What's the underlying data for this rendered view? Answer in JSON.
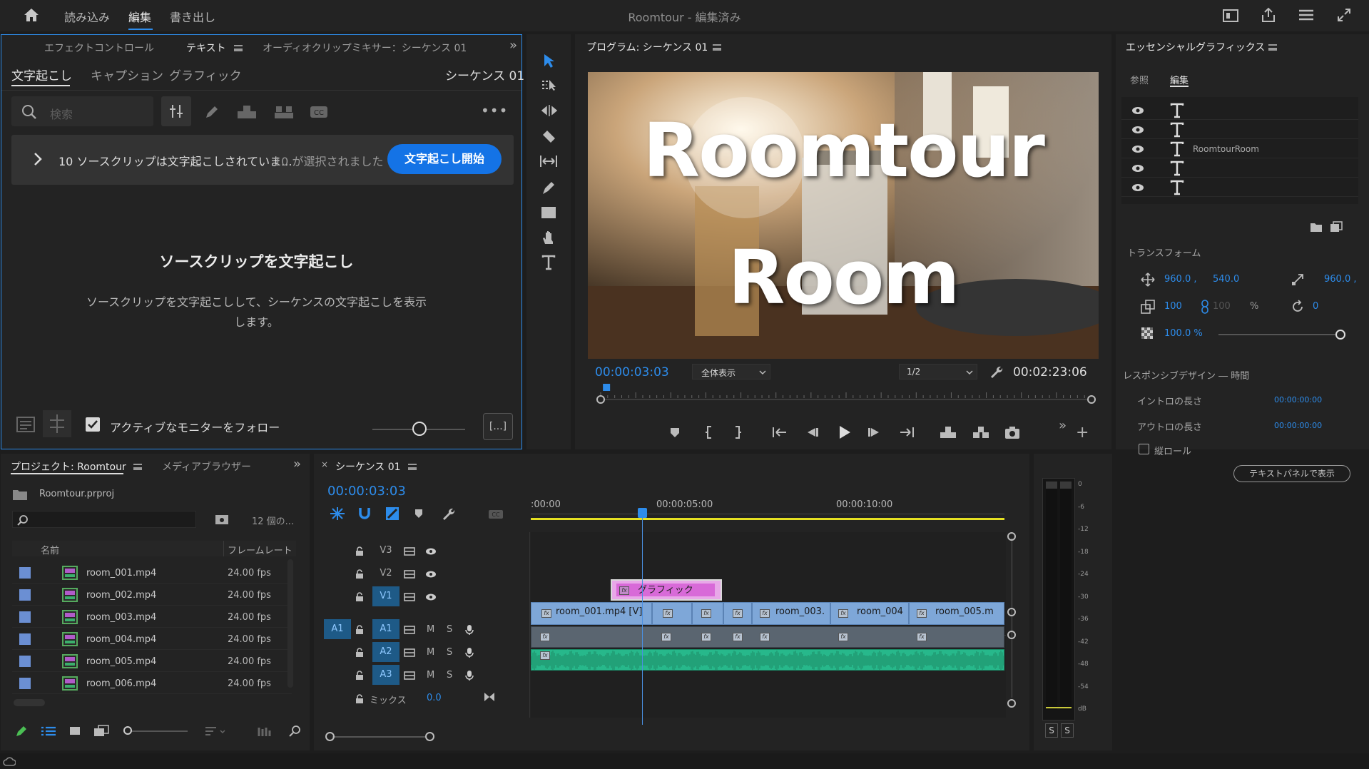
{
  "topbar": {
    "menu": [
      "読み込み",
      "編集",
      "書き出し"
    ],
    "title": "Roomtour - 編集済み"
  },
  "left": {
    "tabs": [
      "エフェクトコントロール",
      "テキスト",
      "オーディオクリップミキサー：シーケンス 01"
    ],
    "subtabs": [
      "文字起こし",
      "キャプション",
      "グラフィック"
    ],
    "sequence": "シーケンス 01",
    "search_placeholder": "検索",
    "banner": {
      "text": "10 ソースクリップは文字起こしされていま...",
      "count": "10 が選択されました",
      "button": "文字起こし開始"
    },
    "empty_title": "ソースクリップを文字起こし",
    "empty_desc_1": "ソースクリップを文字起こしして、シーケンスの文字起こしを表示",
    "empty_desc_2": "します。",
    "follow_label": "アクティブなモニターをフォロー",
    "follow_checked": true,
    "more": "[...]"
  },
  "program": {
    "title": "プログラム: シーケンス 01",
    "video_line1": "Roomtour",
    "video_line2": "Room",
    "timecode": "00:00:03:03",
    "fit": "全体表示",
    "resolution": "1/2",
    "duration": "00:02:23:06",
    "playhead_fraction": 0.0075
  },
  "eg": {
    "title": "エッセンシャルグラフィックス",
    "tabs": [
      "参照",
      "編集"
    ],
    "layers": [
      {
        "label": ""
      },
      {
        "label": ""
      },
      {
        "label": "RoomtourRoom"
      },
      {
        "label": ""
      },
      {
        "label": ""
      }
    ],
    "transform_title": "トランスフォーム",
    "pos_x": "960.0 ,",
    "pos_y": "540.0",
    "anchor": "960.0 ,",
    "scale": "100",
    "scale_h": "100",
    "pct": "%",
    "rotation": "0",
    "opacity": "100.0 %",
    "responsive_title": "レスポンシブデザイン ― 時間",
    "intro_label": "イントロの長さ",
    "intro_value": "00:00:00:00",
    "outro_label": "アウトロの長さ",
    "outro_value": "00:00:00:00",
    "roll_label": "縦ロール",
    "text_panel_btn": "テキストパネルで表示"
  },
  "project": {
    "tabs": [
      "プロジェクト: Roomtour",
      "メディアブラウザー"
    ],
    "file": "Roomtour.prproj",
    "count": "12 個の...",
    "cols": [
      "名前",
      "フレームレート"
    ],
    "items": [
      {
        "name": "room_001.mp4",
        "fps": "24.00 fps"
      },
      {
        "name": "room_002.mp4",
        "fps": "24.00 fps"
      },
      {
        "name": "room_003.mp4",
        "fps": "24.00 fps"
      },
      {
        "name": "room_004.mp4",
        "fps": "24.00 fps"
      },
      {
        "name": "room_005.mp4",
        "fps": "24.00 fps"
      },
      {
        "name": "room_006.mp4",
        "fps": "24.00 fps"
      }
    ]
  },
  "timeline": {
    "tab": "シーケンス 01",
    "timecode": "00:00:03:03",
    "ruler": [
      ":00:00",
      "00:00:05:00",
      "00:00:10:00"
    ],
    "tracks_v": [
      "V3",
      "V2",
      "V1"
    ],
    "tracks_a": [
      "A1",
      "A2",
      "A3"
    ],
    "src_a1": "A1",
    "m": "M",
    "s": "S",
    "mix_label": "ミックス",
    "mix_value": "0.0",
    "graphic_clip": "グラフィック",
    "clips": [
      "room_001.mp4 [V]",
      "room_003.",
      "room_004",
      "room_005.m"
    ]
  },
  "meter": {
    "scale": [
      "0",
      "-6",
      "-12",
      "-18",
      "-24",
      "-30",
      "-36",
      "-42",
      "-48",
      "-54",
      "dB"
    ],
    "solo": [
      "S",
      "S"
    ]
  }
}
